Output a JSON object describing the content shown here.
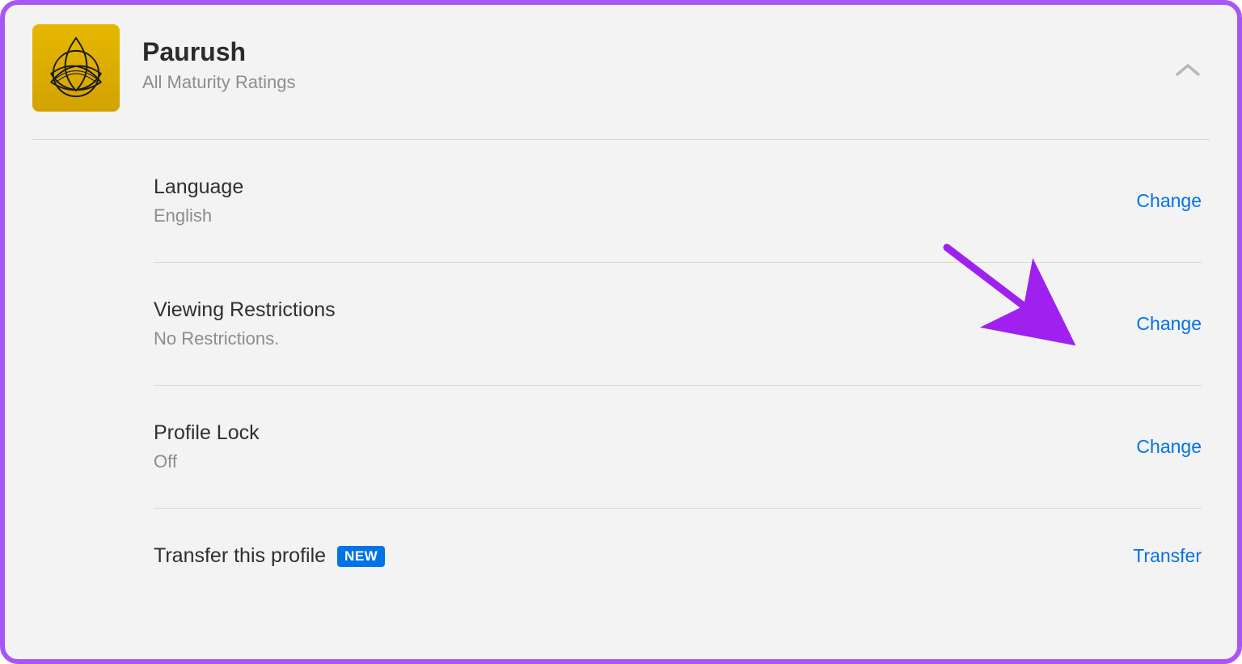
{
  "profile": {
    "name": "Paurush",
    "maturity": "All Maturity Ratings"
  },
  "rows": {
    "language": {
      "title": "Language",
      "value": "English",
      "action": "Change"
    },
    "viewing": {
      "title": "Viewing Restrictions",
      "value": "No Restrictions.",
      "action": "Change"
    },
    "lock": {
      "title": "Profile Lock",
      "value": "Off",
      "action": "Change"
    },
    "transfer": {
      "title": "Transfer this profile",
      "badge": "NEW",
      "action": "Transfer"
    }
  }
}
